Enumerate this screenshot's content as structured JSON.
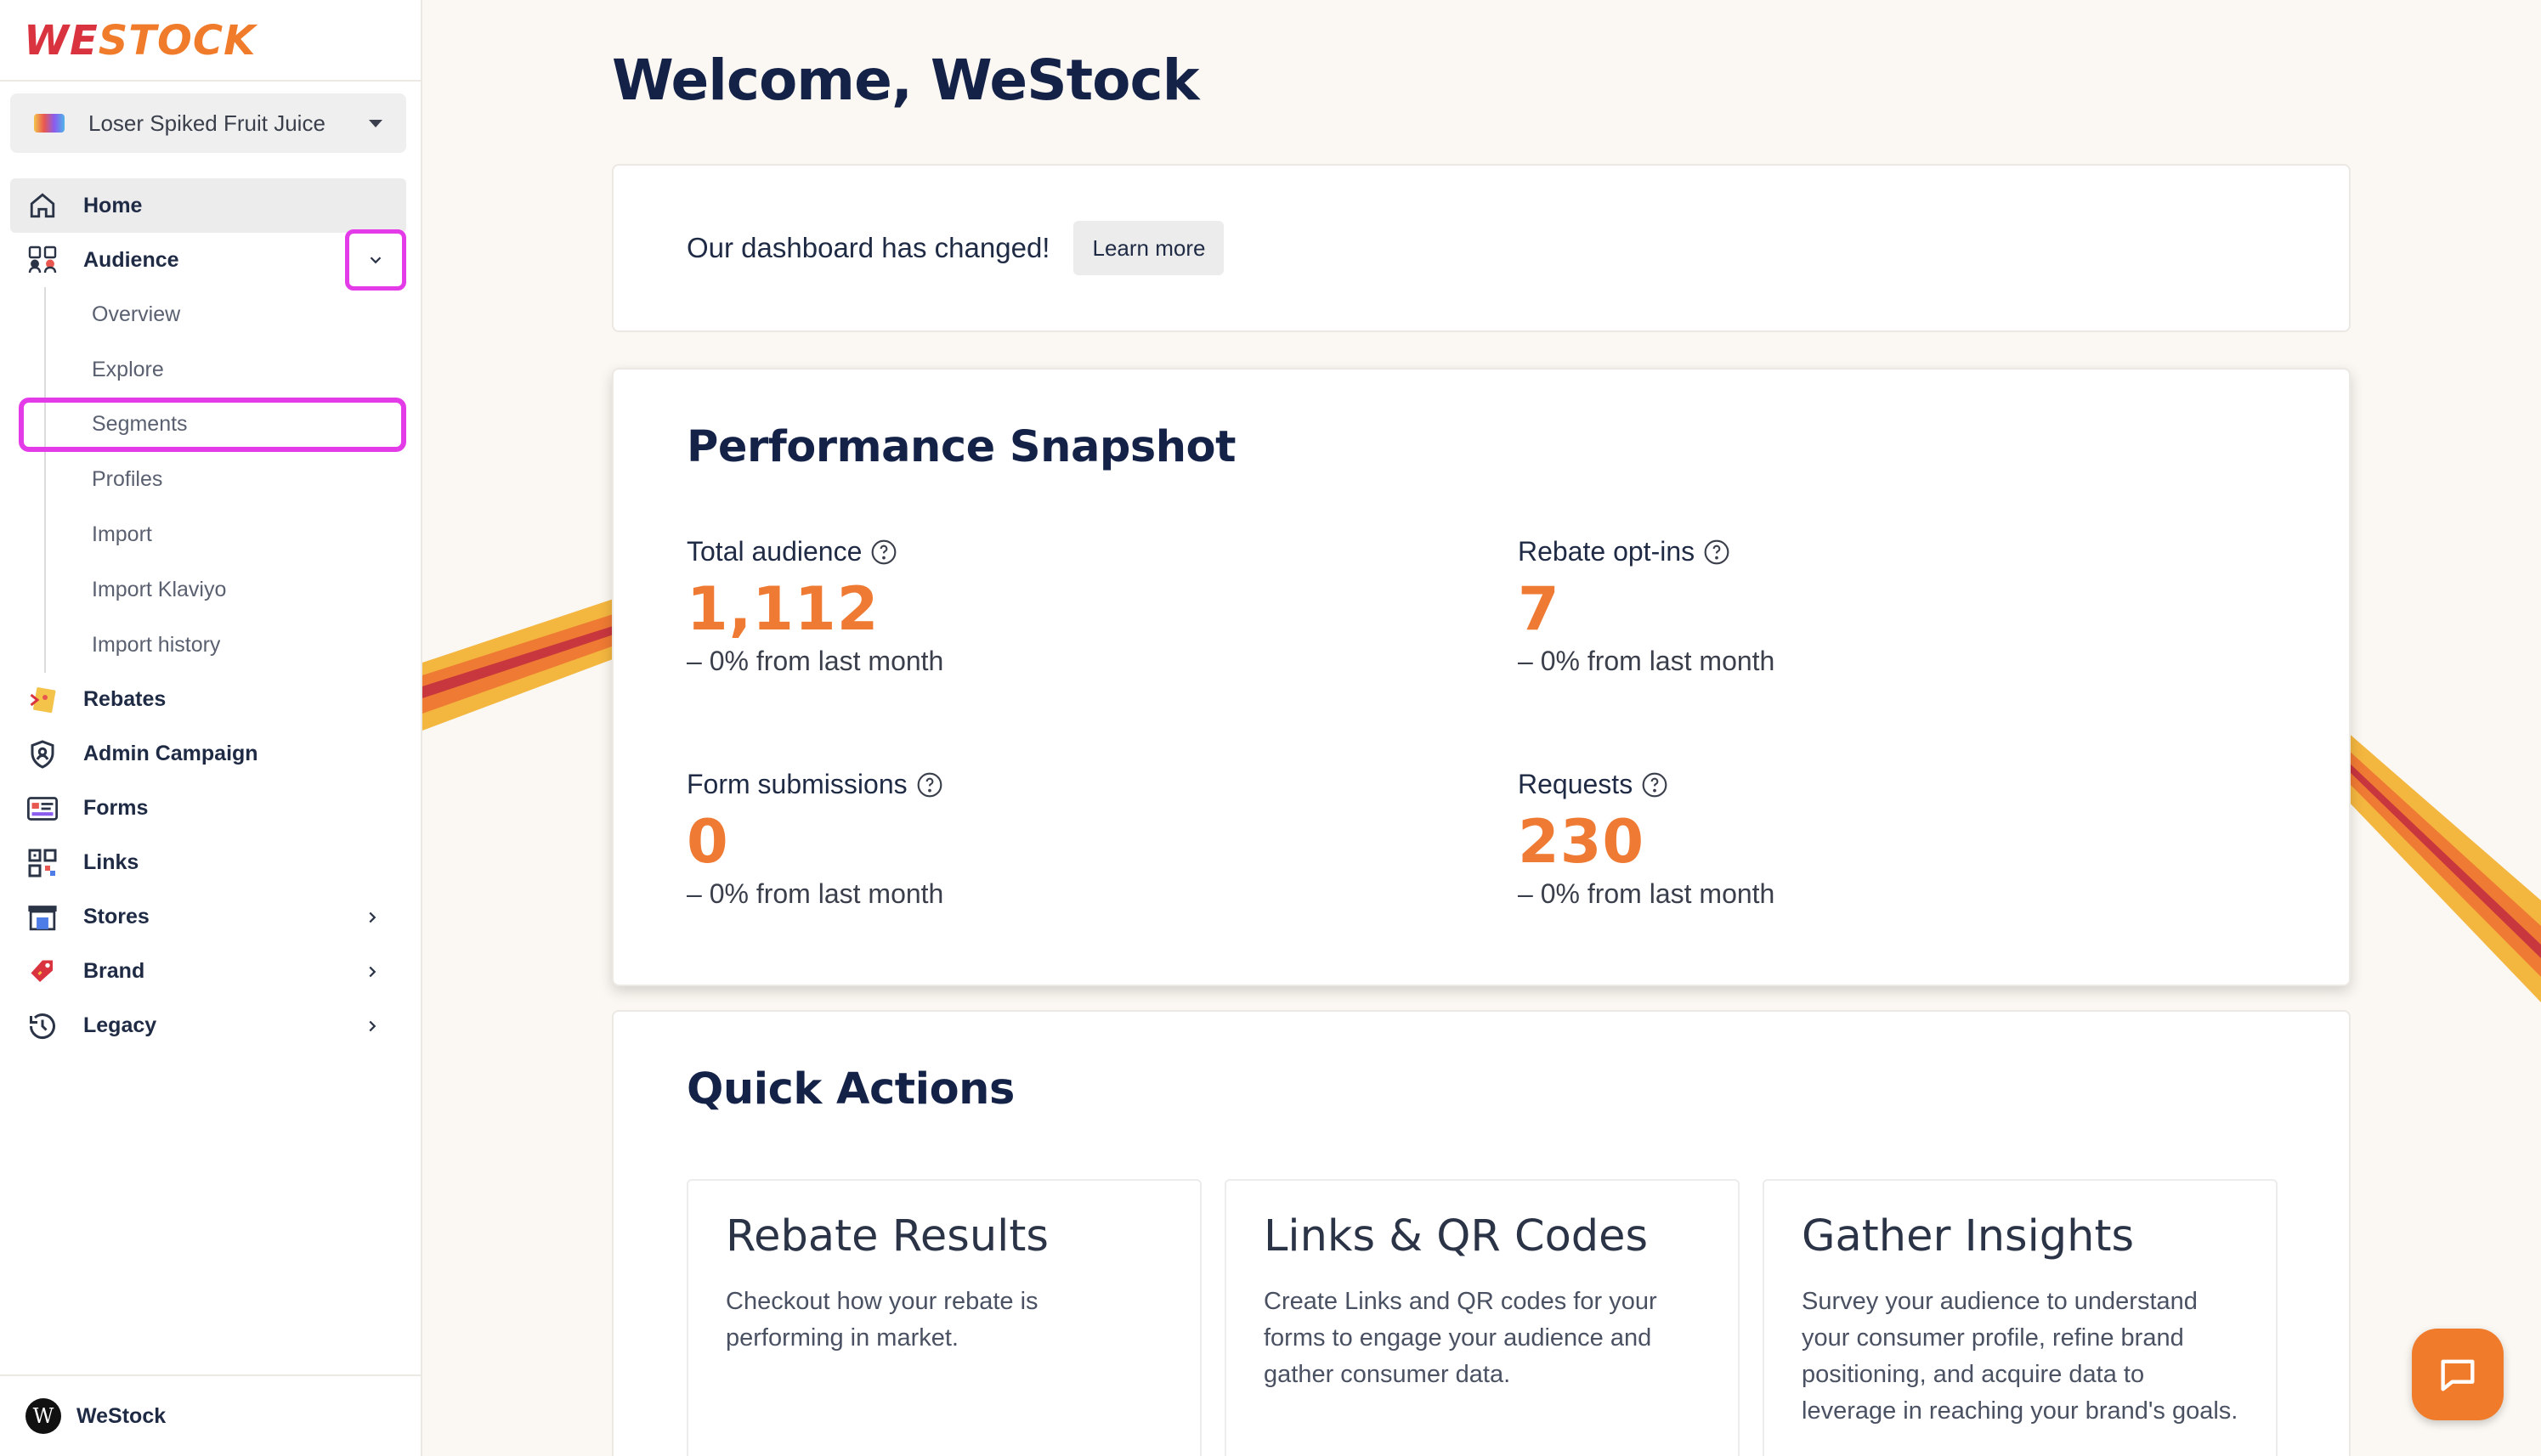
{
  "brand": {
    "logo_we": "WE",
    "logo_stock": "STOCK",
    "selected": "Loser Spiked Fruit Juice"
  },
  "sidebar": {
    "items": [
      {
        "label": "Home",
        "icon": "home-icon"
      },
      {
        "label": "Audience",
        "icon": "audience-icon",
        "sub": [
          "Overview",
          "Explore",
          "Segments",
          "Profiles",
          "Import",
          "Import Klaviyo",
          "Import history"
        ]
      },
      {
        "label": "Rebates",
        "icon": "rebates-icon"
      },
      {
        "label": "Admin Campaign",
        "icon": "shield-icon"
      },
      {
        "label": "Forms",
        "icon": "forms-icon"
      },
      {
        "label": "Links",
        "icon": "qr-icon"
      },
      {
        "label": "Stores",
        "icon": "store-icon"
      },
      {
        "label": "Brand",
        "icon": "tag-icon"
      },
      {
        "label": "Legacy",
        "icon": "history-icon"
      }
    ],
    "user": {
      "avatar_letter": "W",
      "name": "WeStock"
    }
  },
  "main": {
    "title": "Welcome, WeStock",
    "banner": {
      "text": "Our dashboard has changed!",
      "button": "Learn more"
    },
    "performance": {
      "title": "Performance Snapshot",
      "metrics": [
        {
          "label": "Total audience",
          "value": "1,112",
          "delta": "– 0% from last month"
        },
        {
          "label": "Rebate opt-ins",
          "value": "7",
          "delta": "– 0% from last month"
        },
        {
          "label": "Form submissions",
          "value": "0",
          "delta": "– 0% from last month"
        },
        {
          "label": "Requests",
          "value": "230",
          "delta": "– 0% from last month"
        }
      ]
    },
    "quick_actions": {
      "title": "Quick Actions",
      "cards": [
        {
          "title": "Rebate Results",
          "desc": "Checkout how your rebate is performing in market."
        },
        {
          "title": "Links & QR Codes",
          "desc": "Create Links and QR codes for your forms to engage your audience and gather consumer data."
        },
        {
          "title": "Gather Insights",
          "desc": "Survey your audience to understand your consumer profile, refine brand positioning, and acquire data to leverage in reaching your brand's goals."
        }
      ]
    }
  },
  "colors": {
    "accent": "#ef7a33",
    "highlight": "#e43be8",
    "navy": "#142248"
  }
}
